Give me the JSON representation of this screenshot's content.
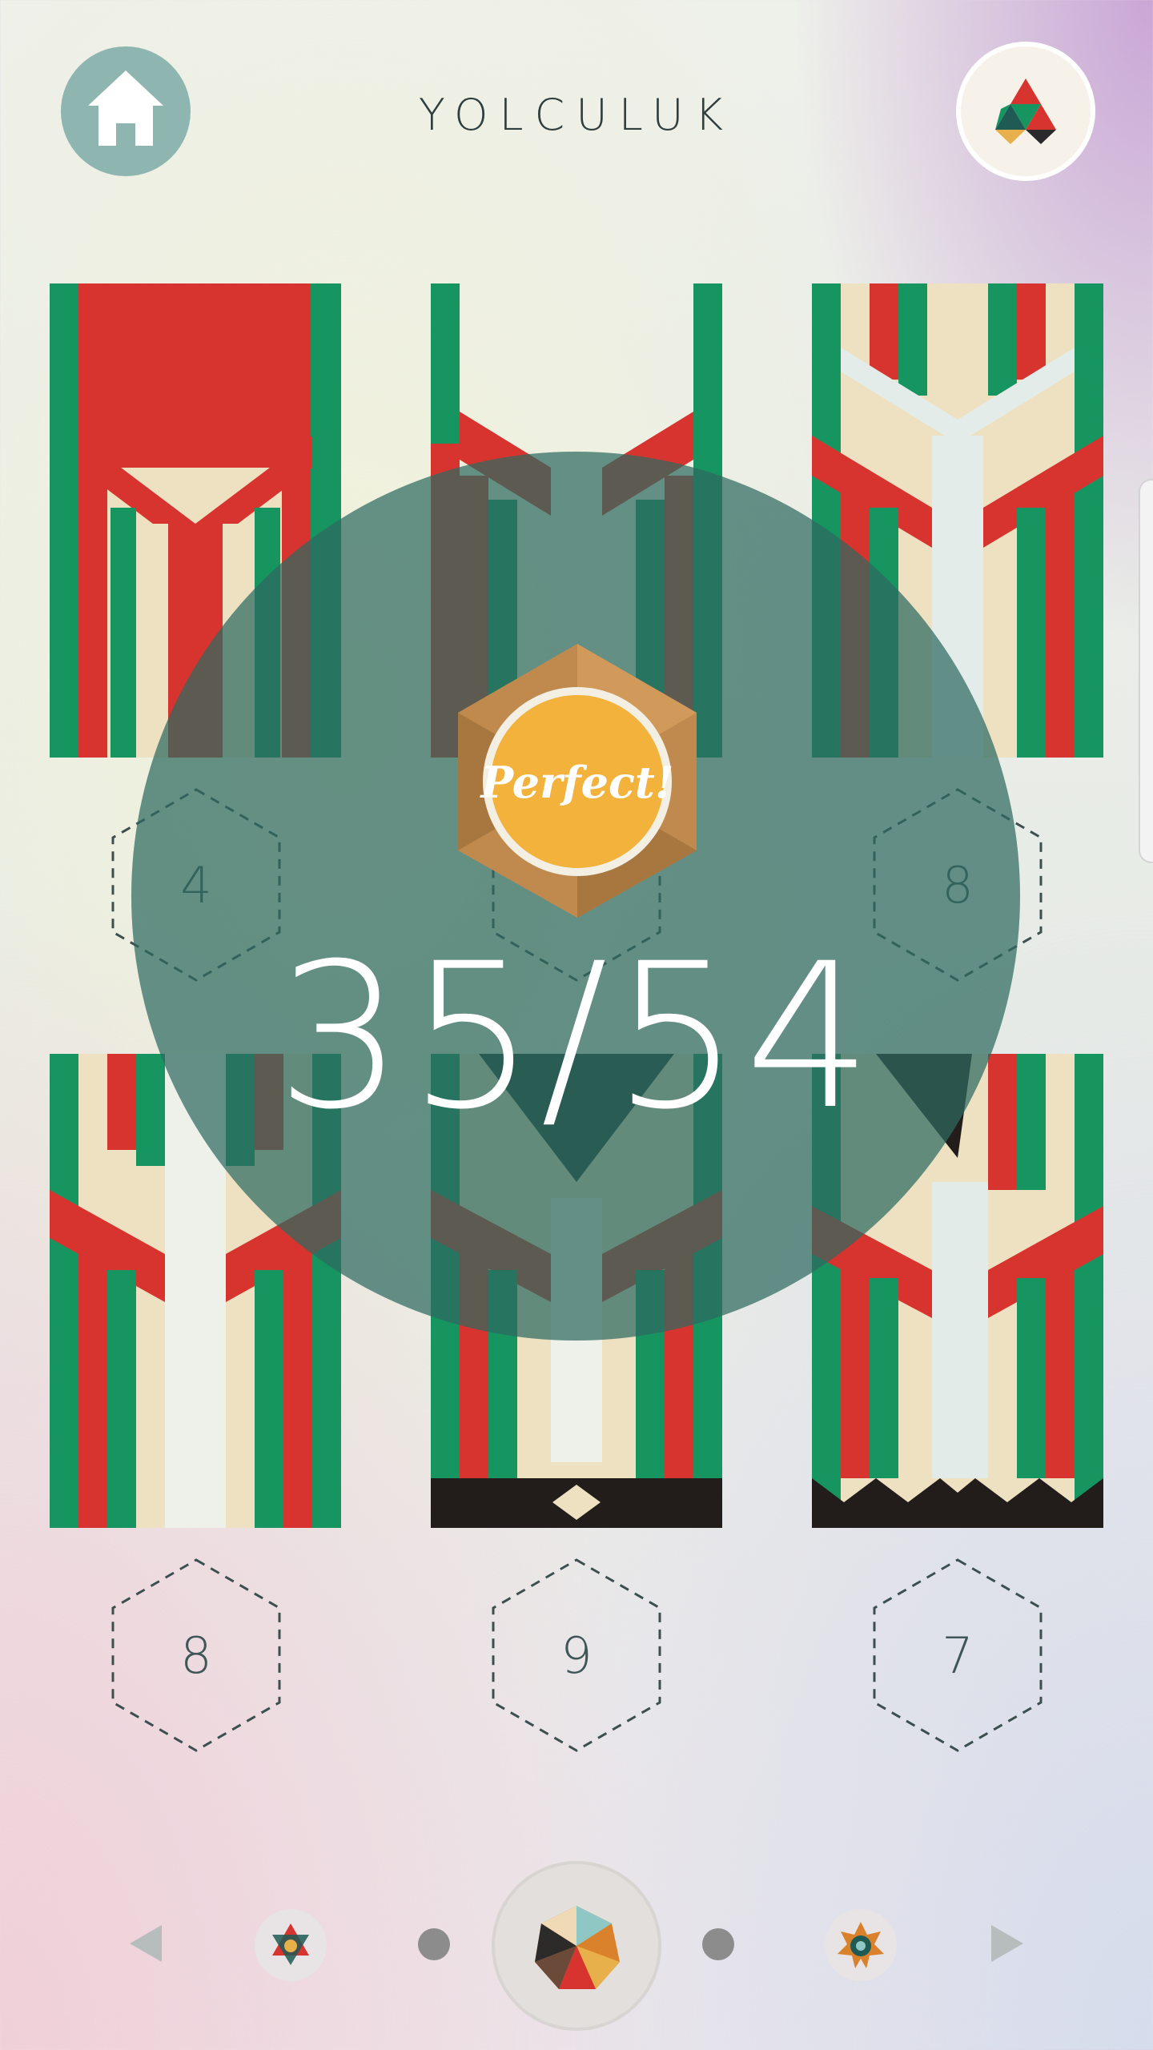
{
  "header": {
    "title": "YOLCULUK",
    "home_icon": "home-icon",
    "emblem_icon": "triangle-emblem-icon"
  },
  "colors": {
    "red": "#d8342f",
    "green": "#179560",
    "cream": "#eee1c2",
    "dark": "#221d1b",
    "overlay": "#2e6a60",
    "medal_gold": "#f2b23c"
  },
  "badges": [
    {
      "label": "4"
    },
    {
      "label": ""
    },
    {
      "label": "8"
    },
    {
      "label": "8"
    },
    {
      "label": "9"
    },
    {
      "label": "7"
    }
  ],
  "result": {
    "score": "35/54",
    "medal_text": "Perfect!"
  },
  "footer": {
    "prev_icon": "left-arrow-icon",
    "next_icon": "right-arrow-icon",
    "levels": [
      "star-emblem-icon",
      "pager-dot",
      "polyhedron-emblem-icon",
      "pager-dot",
      "sun-emblem-icon"
    ]
  }
}
